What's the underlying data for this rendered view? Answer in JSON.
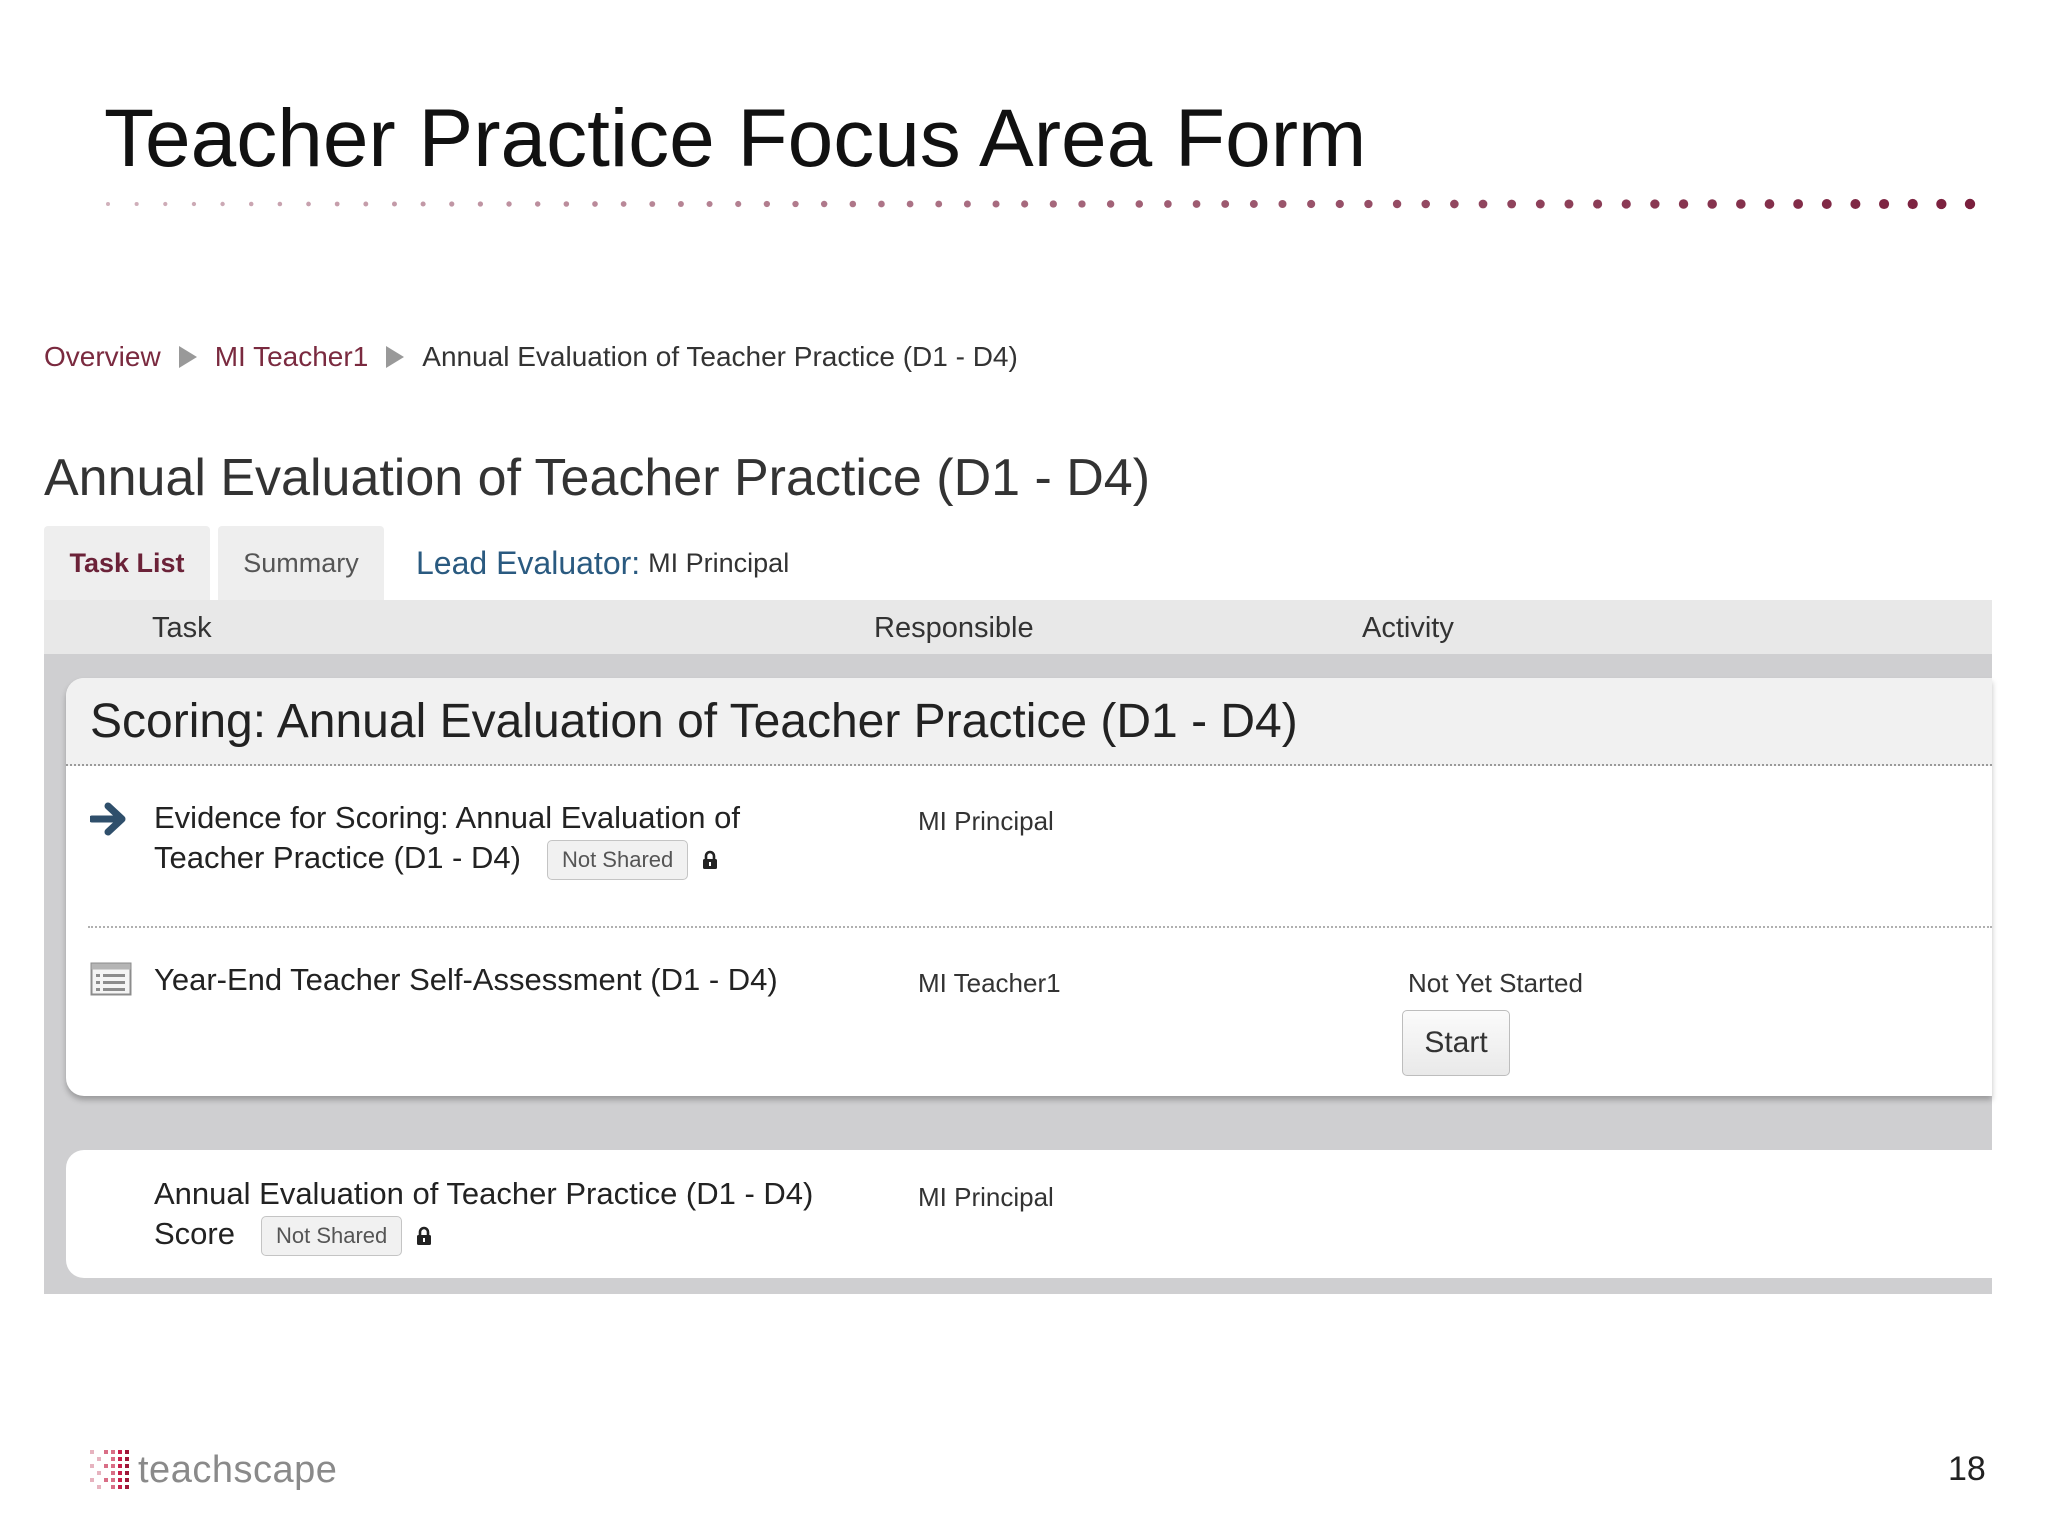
{
  "slide": {
    "title": "Teacher Practice Focus Area Form",
    "page_number": "18",
    "accent_color": "#7a1f3d"
  },
  "breadcrumb": {
    "items": [
      "Overview",
      "MI Teacher1",
      "Annual Evaluation of Teacher Practice (D1 - D4)"
    ]
  },
  "page": {
    "heading": "Annual Evaluation of Teacher Practice (D1 - D4)"
  },
  "tabs": [
    {
      "label": "Task List",
      "active": true
    },
    {
      "label": "Summary",
      "active": false
    }
  ],
  "lead_evaluator": {
    "label": "Lead Evaluator:",
    "value": "MI Principal"
  },
  "table": {
    "columns": [
      "Task",
      "Responsible",
      "Activity"
    ]
  },
  "scoring_section": {
    "title": "Scoring: Annual Evaluation of Teacher Practice (D1 - D4)",
    "rows": [
      {
        "icon": "arrow-right-icon",
        "task_line1": "Evidence for Scoring: Annual Evaluation of",
        "task_line2": "Teacher Practice (D1 - D4)",
        "badge": "Not Shared",
        "responsible": "MI Principal",
        "activity": ""
      },
      {
        "icon": "form-list-icon",
        "task_line1": "Year-End Teacher Self-Assessment (D1 - D4)",
        "responsible": "MI Teacher1",
        "activity": "Not Yet Started",
        "action": "Start"
      }
    ]
  },
  "score_row": {
    "task_line1": "Annual Evaluation of Teacher Practice (D1 - D4)",
    "task_line2": "Score",
    "badge": "Not Shared",
    "responsible": "MI Principal"
  },
  "logo": {
    "text": "teachscape",
    "icon": "dot-grid-logo-icon"
  }
}
